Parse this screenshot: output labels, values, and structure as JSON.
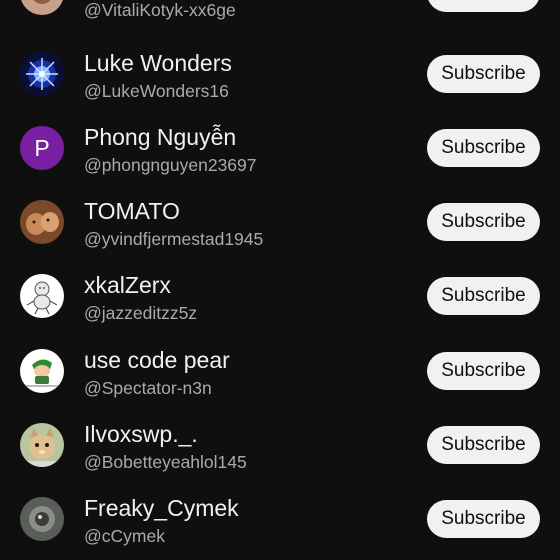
{
  "channels": [
    {
      "name": "",
      "handle": "@VitaliKotyk-xx6ge",
      "avatar_icon": "photo-avatar-icon",
      "button_label": "Subscribe"
    },
    {
      "name": "Luke Wonders",
      "handle": "@LukeWonders16",
      "avatar_icon": "blue-spark-avatar-icon",
      "button_label": "Subscribe"
    },
    {
      "name": "Phong Nguyễn",
      "handle": "@phongnguyen23697",
      "avatar_icon": "letter-avatar-icon",
      "avatar_letter": "P",
      "avatar_color": "#7b1fa2",
      "button_label": "Subscribe"
    },
    {
      "name": "TOMATO",
      "handle": "@yvindfjermestad1945",
      "avatar_icon": "animal-photo-avatar-icon",
      "button_label": "Subscribe"
    },
    {
      "name": "xkalZerx",
      "handle": "@jazzeditzz5z",
      "avatar_icon": "sketch-figure-avatar-icon",
      "button_label": "Subscribe"
    },
    {
      "name": "use code pear",
      "handle": "@Spectator-n3n",
      "avatar_icon": "cartoon-character-avatar-icon",
      "button_label": "Subscribe"
    },
    {
      "name": "Ilvoxswp._.",
      "handle": "@Bobetteyeahlol145",
      "avatar_icon": "cat-photo-avatar-icon",
      "button_label": "Subscribe"
    },
    {
      "name": "Freaky_Cymek",
      "handle": "@cCymek",
      "avatar_icon": "photo-avatar-icon",
      "button_label": "Subscribe"
    }
  ],
  "colors": {
    "background": "#0f0f0f",
    "button_bg": "#f1f1f1",
    "button_text": "#0f0f0f",
    "handle_text": "#aaaaaa"
  }
}
